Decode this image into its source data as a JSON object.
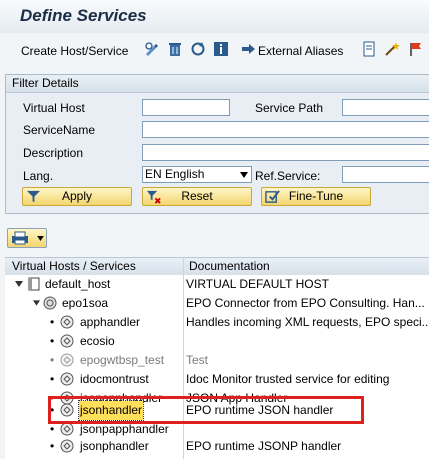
{
  "window": {
    "title": "Define Services"
  },
  "toolbar": {
    "create_host_service": "Create Host/Service",
    "external_aliases": "External Aliases"
  },
  "filter": {
    "header": "Filter Details",
    "virtual_host_label": "Virtual Host",
    "virtual_host_value": "",
    "service_path_label": "Service Path",
    "service_path_value": "",
    "service_name_label": "ServiceName",
    "service_name_value": "",
    "description_label": "Description",
    "description_value": "",
    "lang_label": "Lang.",
    "lang_value": "EN English",
    "ref_service_label": "Ref.Service:",
    "ref_service_value": "",
    "apply_label": "Apply",
    "reset_label": "Reset",
    "fine_tune_label": "Fine-Tune"
  },
  "tree": {
    "col_services": "Virtual Hosts / Services",
    "col_documentation": "Documentation",
    "rows": [
      {
        "name": "default_host",
        "doc": "VIRTUAL DEFAULT HOST",
        "state": "active"
      },
      {
        "name": "epo1soa",
        "doc": "EPO Connector from EPO Consulting. Han...",
        "state": "active"
      },
      {
        "name": "apphandler",
        "doc": "Handles incoming XML requests, EPO speci...",
        "state": "active"
      },
      {
        "name": "ecosio",
        "doc": "",
        "state": "active"
      },
      {
        "name": "epogwtbsp_test",
        "doc": "Test",
        "state": "inactive"
      },
      {
        "name": "idocmontrust",
        "doc": "Idoc Monitor trusted service for editing",
        "state": "active"
      },
      {
        "name": "jsonapphandler",
        "doc": "JSON App Handler",
        "state": "active"
      },
      {
        "name": "jsonhandler",
        "doc": "EPO runtime JSON handler",
        "state": "selected"
      },
      {
        "name": "jsonpapphandler",
        "doc": "",
        "state": "active"
      },
      {
        "name": "jsonphandler",
        "doc": "EPO runtime JSONP handler",
        "state": "active"
      }
    ]
  },
  "colors": {
    "highlight": "#e0201c",
    "selection": "#ffde59",
    "button": "#f3d56f"
  }
}
